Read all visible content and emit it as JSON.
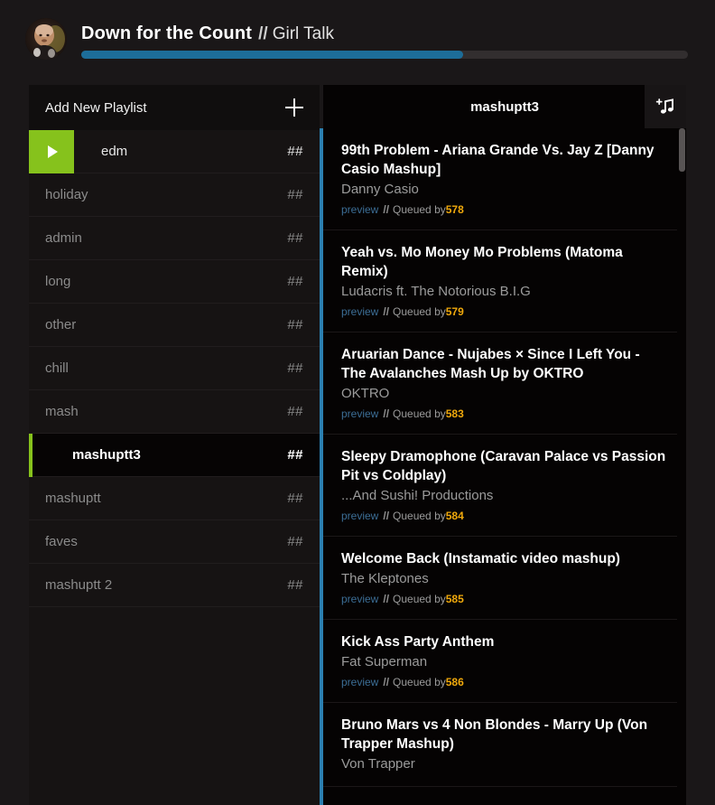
{
  "now_playing": {
    "title": "Down for the Count",
    "separator": "//",
    "artist": "Girl Talk",
    "progress_percent": 63,
    "avatar_icon": "user-avatar-photo"
  },
  "sidebar": {
    "header": {
      "label": "Add New Playlist",
      "add_icon": "plus-icon"
    },
    "items": [
      {
        "name": "edm",
        "count": "##",
        "state": "playing",
        "play_icon": "play-triangle-icon"
      },
      {
        "name": "holiday",
        "count": "##",
        "state": "normal"
      },
      {
        "name": "admin",
        "count": "##",
        "state": "normal"
      },
      {
        "name": "long",
        "count": "##",
        "state": "normal"
      },
      {
        "name": "other",
        "count": "##",
        "state": "normal"
      },
      {
        "name": "chill",
        "count": "##",
        "state": "normal"
      },
      {
        "name": "mash",
        "count": "##",
        "state": "normal"
      },
      {
        "name": "mashuptt3",
        "count": "##",
        "state": "selected"
      },
      {
        "name": "mashuptt",
        "count": "##",
        "state": "normal"
      },
      {
        "name": "faves",
        "count": "##",
        "state": "normal"
      },
      {
        "name": "mashuptt 2",
        "count": "##",
        "state": "normal"
      }
    ]
  },
  "tracks_panel": {
    "title": "mashuptt3",
    "add_music_icon": "add-music-note-icon",
    "meta_labels": {
      "preview": "preview",
      "separator": "//",
      "queued_by": "Queued by"
    },
    "tracks": [
      {
        "title": "99th Problem - Ariana Grande Vs. Jay Z [Danny Casio Mashup]",
        "artist": "Danny Casio",
        "queued_by": "578"
      },
      {
        "title": "Yeah vs. Mo Money Mo Problems (Matoma Remix)",
        "artist": "Ludacris ft. The Notorious B.I.G",
        "queued_by": "579"
      },
      {
        "title": "Aruarian Dance - Nujabes × Since I Left You - The Avalanches Mash Up by OKTRO",
        "artist": "OKTRO",
        "queued_by": "583"
      },
      {
        "title": "Sleepy Dramophone (Caravan Palace vs Passion Pit vs Coldplay)",
        "artist": "...And Sushi! Productions",
        "queued_by": "584"
      },
      {
        "title": "Welcome Back (Instamatic video mashup)",
        "artist": "The Kleptones",
        "queued_by": "585"
      },
      {
        "title": "Kick Ass Party Anthem",
        "artist": "Fat Superman",
        "queued_by": "586"
      },
      {
        "title": "Bruno Mars vs 4 Non Blondes - Marry Up (Von Trapper Mashup)",
        "artist": "Von Trapper",
        "queued_by": ""
      }
    ]
  },
  "colors": {
    "page_background": "#1a1718",
    "sidebar_background": "#161313",
    "panel_background": "#050303",
    "accent_green": "#86c21c",
    "accent_blue": "#2b7fb0",
    "progress_blue": "#1d6d99",
    "queued_number": "#f0a90c",
    "preview_link": "#3c6e96"
  }
}
